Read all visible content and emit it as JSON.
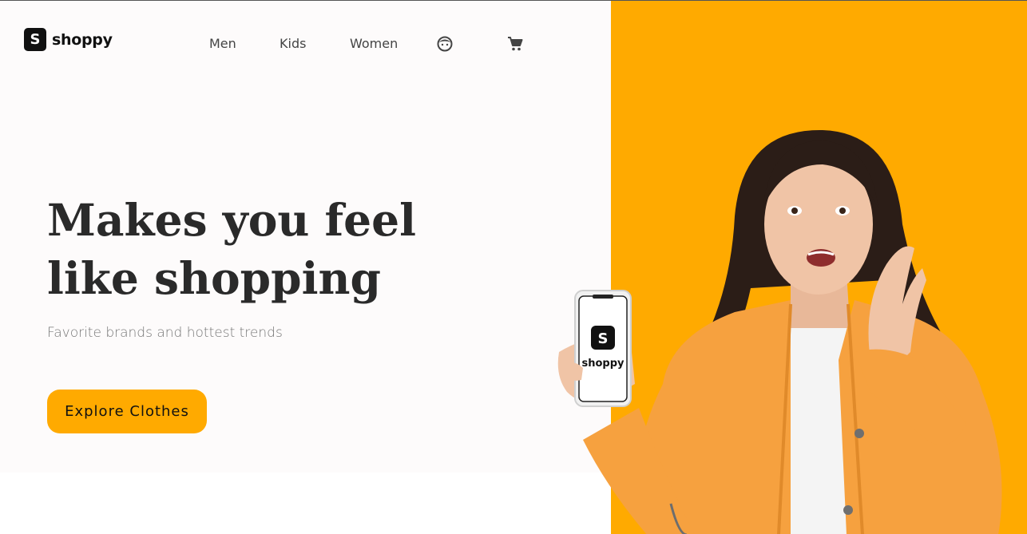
{
  "brand": {
    "name": "shoppy",
    "mark": "S"
  },
  "nav": {
    "links": [
      "Men",
      "Kids",
      "Women"
    ],
    "icons": [
      "avatar-icon",
      "cart-icon"
    ]
  },
  "hero": {
    "headline_line1": "Makes you feel",
    "headline_line2": "like shopping",
    "subline": "Favorite brands and hottest trends",
    "cta_label": "Explore Clothes",
    "phone_brand": "shoppy",
    "phone_mark": "S"
  },
  "colors": {
    "accent": "#ffaa00",
    "text_dark": "#2a2a2a",
    "background": "#fdfbfb"
  }
}
